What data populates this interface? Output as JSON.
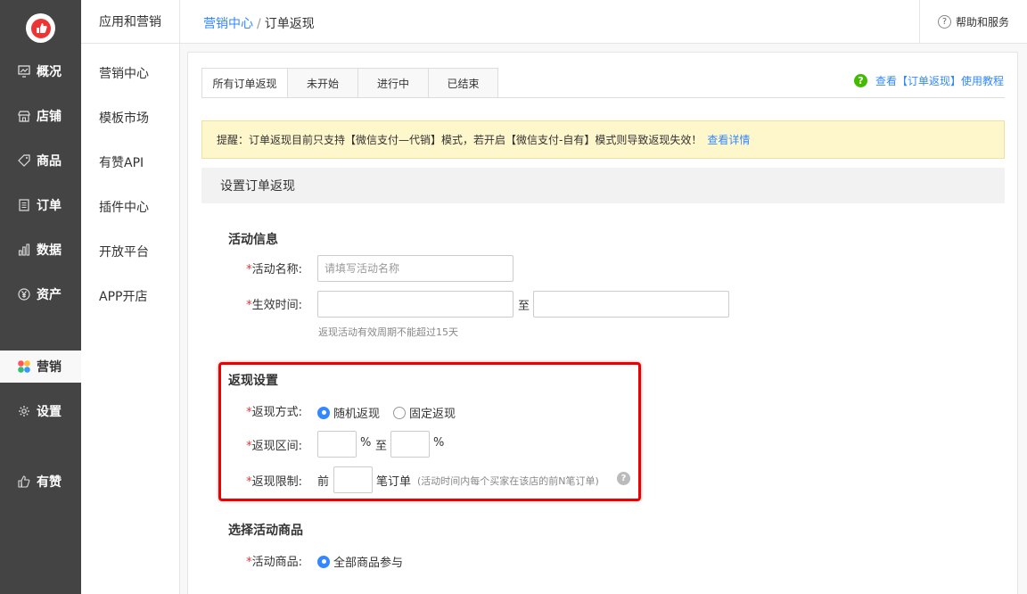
{
  "nav_primary": {
    "items": [
      {
        "label": "概况",
        "icon": "dashboard-icon"
      },
      {
        "label": "店铺",
        "icon": "store-icon"
      },
      {
        "label": "商品",
        "icon": "tag-icon"
      },
      {
        "label": "订单",
        "icon": "order-icon"
      },
      {
        "label": "数据",
        "icon": "bar-chart-icon"
      },
      {
        "label": "资产",
        "icon": "yen-icon"
      },
      {
        "label": "营销",
        "icon": "marketing-icon",
        "active": true
      },
      {
        "label": "设置",
        "icon": "gear-icon"
      },
      {
        "label": "有赞",
        "icon": "thumb-up-icon"
      }
    ]
  },
  "nav_secondary": {
    "title": "应用和营销",
    "items": [
      "营销中心",
      "模板市场",
      "有赞API",
      "插件中心",
      "开放平台",
      "APP开店"
    ]
  },
  "header": {
    "breadcrumb_link": "营销中心",
    "breadcrumb_sep": "/",
    "breadcrumb_current": "订单返现",
    "help": "帮助和服务",
    "help_icon_text": "?"
  },
  "tabs": [
    "所有订单返现",
    "未开始",
    "进行中",
    "已结束"
  ],
  "tutorial": {
    "icon_text": "?",
    "label": "查看【订单返现】使用教程"
  },
  "notice": {
    "text": "提醒：订单返现目前只支持【微信支付—代销】模式，若开启【微信支付-自有】模式则导致返现失效！",
    "link": "查看详情"
  },
  "section_title": "设置订单返现",
  "activity_info": {
    "title": "活动信息",
    "name_label": "活动名称:",
    "name_placeholder": "请填写活动名称",
    "time_label": "生效时间:",
    "time_to": "至",
    "time_hint": "返现活动有效周期不能超过15天"
  },
  "cashback": {
    "title": "返现设置",
    "method_label": "返现方式:",
    "method_options": [
      "随机返现",
      "固定返现"
    ],
    "method_selected": "随机返现",
    "range_label": "返现区间:",
    "range_percent": "%",
    "range_to": "至",
    "limit_label": "返现限制:",
    "limit_prefix": "前",
    "limit_suffix": "笔订单",
    "limit_hint": "(活动时间内每个买家在该店的前N笔订单)",
    "hint_icon_text": "?"
  },
  "products": {
    "title": "选择活动商品",
    "label": "活动商品:",
    "option": "全部商品参与"
  },
  "required_mark": "*",
  "colors": {
    "accent": "#3388ff",
    "sidebar": "#444444",
    "required": "#ee3333",
    "highlight": "#ee0000"
  }
}
